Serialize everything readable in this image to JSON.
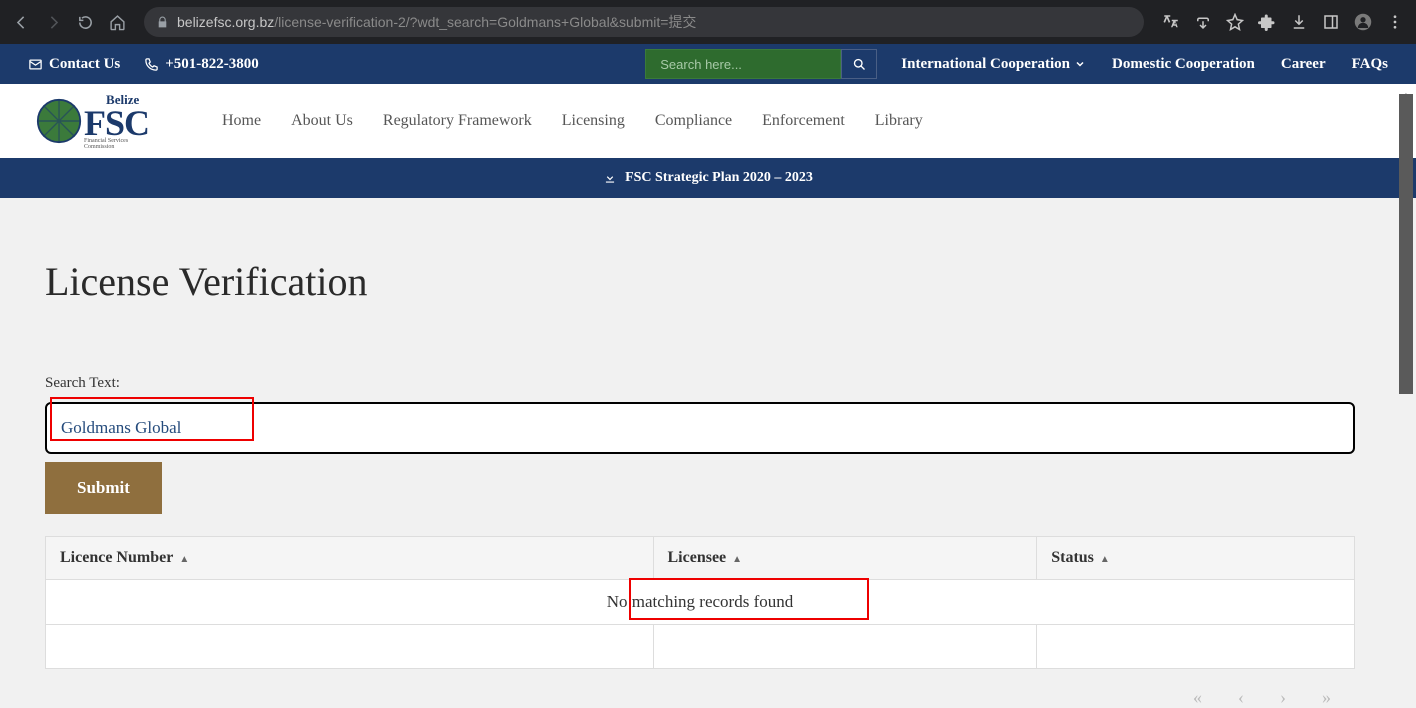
{
  "browser": {
    "url_host": "belizefsc.org.bz",
    "url_path": "/license-verification-2/?wdt_search=Goldmans+Global&submit=提交"
  },
  "topbar": {
    "contact": "Contact Us",
    "phone": "+501-822-3800",
    "search_placeholder": "Search here...",
    "links": {
      "intl": "International Cooperation",
      "domestic": "Domestic Cooperation",
      "career": "Career",
      "faqs": "FAQs"
    }
  },
  "logo": {
    "top": "Belize",
    "main": "FSC",
    "sub": "Financial Services Commission"
  },
  "nav": {
    "home": "Home",
    "about": "About Us",
    "regulatory": "Regulatory Framework",
    "licensing": "Licensing",
    "compliance": "Compliance",
    "enforcement": "Enforcement",
    "library": "Library"
  },
  "banner": "FSC Strategic Plan 2020 – 2023",
  "page": {
    "title": "License Verification",
    "search_label": "Search Text:",
    "search_value": "Goldmans Global",
    "submit": "Submit"
  },
  "table": {
    "col1": "Licence Number",
    "col2": "Licensee",
    "col3": "Status",
    "no_results": "No matching records found"
  }
}
